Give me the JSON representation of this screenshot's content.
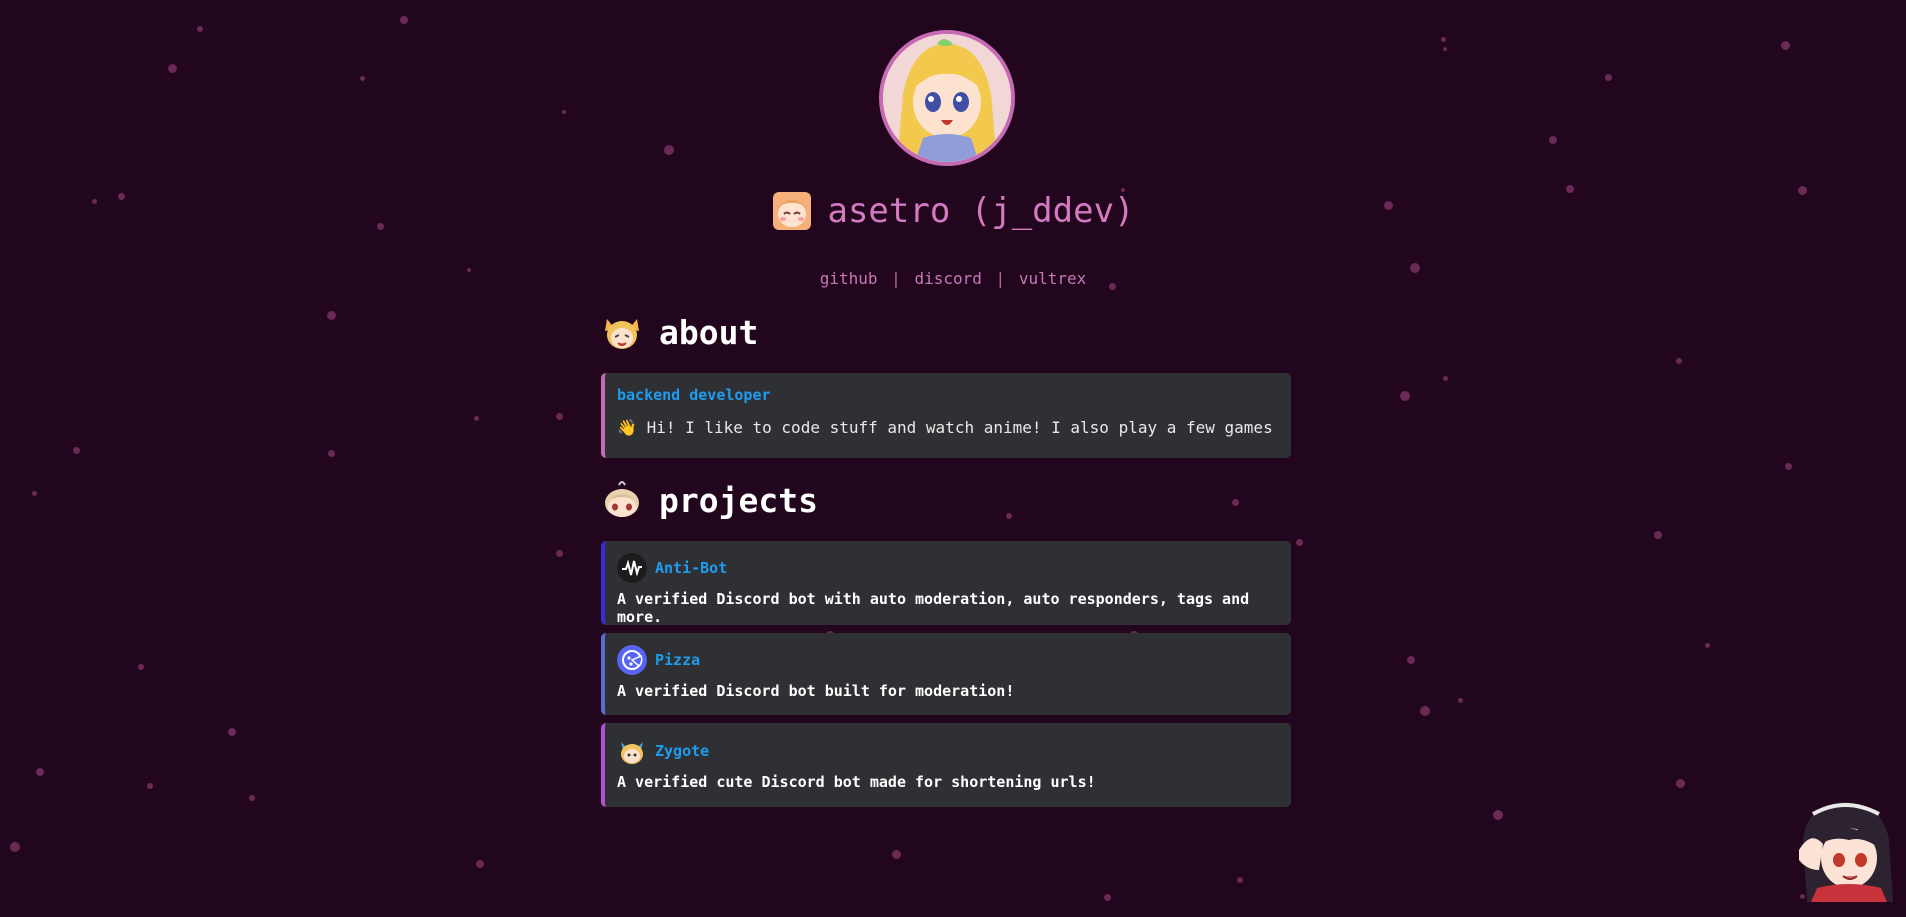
{
  "profile": {
    "name": "asetro (j_ddev)",
    "links": [
      "github",
      "discord",
      "vultrex"
    ],
    "separator": "|"
  },
  "about": {
    "heading": "about",
    "role": "backend developer",
    "emoji": "👋",
    "bio": "Hi! I like to code stuff and watch anime! I also play a few games"
  },
  "projects": {
    "heading": "projects",
    "items": [
      {
        "name": "Anti-Bot",
        "description": "A verified Discord bot with auto moderation, auto responders, tags and more.",
        "icon": "waveform-icon",
        "accent": "#3a2bd6"
      },
      {
        "name": "Pizza",
        "description": "A verified Discord bot built for moderation!",
        "icon": "pizza-icon",
        "accent": "#5b6bd6"
      },
      {
        "name": "Zygote",
        "description": "A verified cute Discord bot made for shortening urls!",
        "icon": "zygote-icon",
        "accent": "#b34fd6"
      }
    ]
  },
  "colors": {
    "background": "#22061e",
    "accent_pink": "#d37ac0",
    "link_blue": "#1e9cf0",
    "card_bg": "#2f3034"
  }
}
